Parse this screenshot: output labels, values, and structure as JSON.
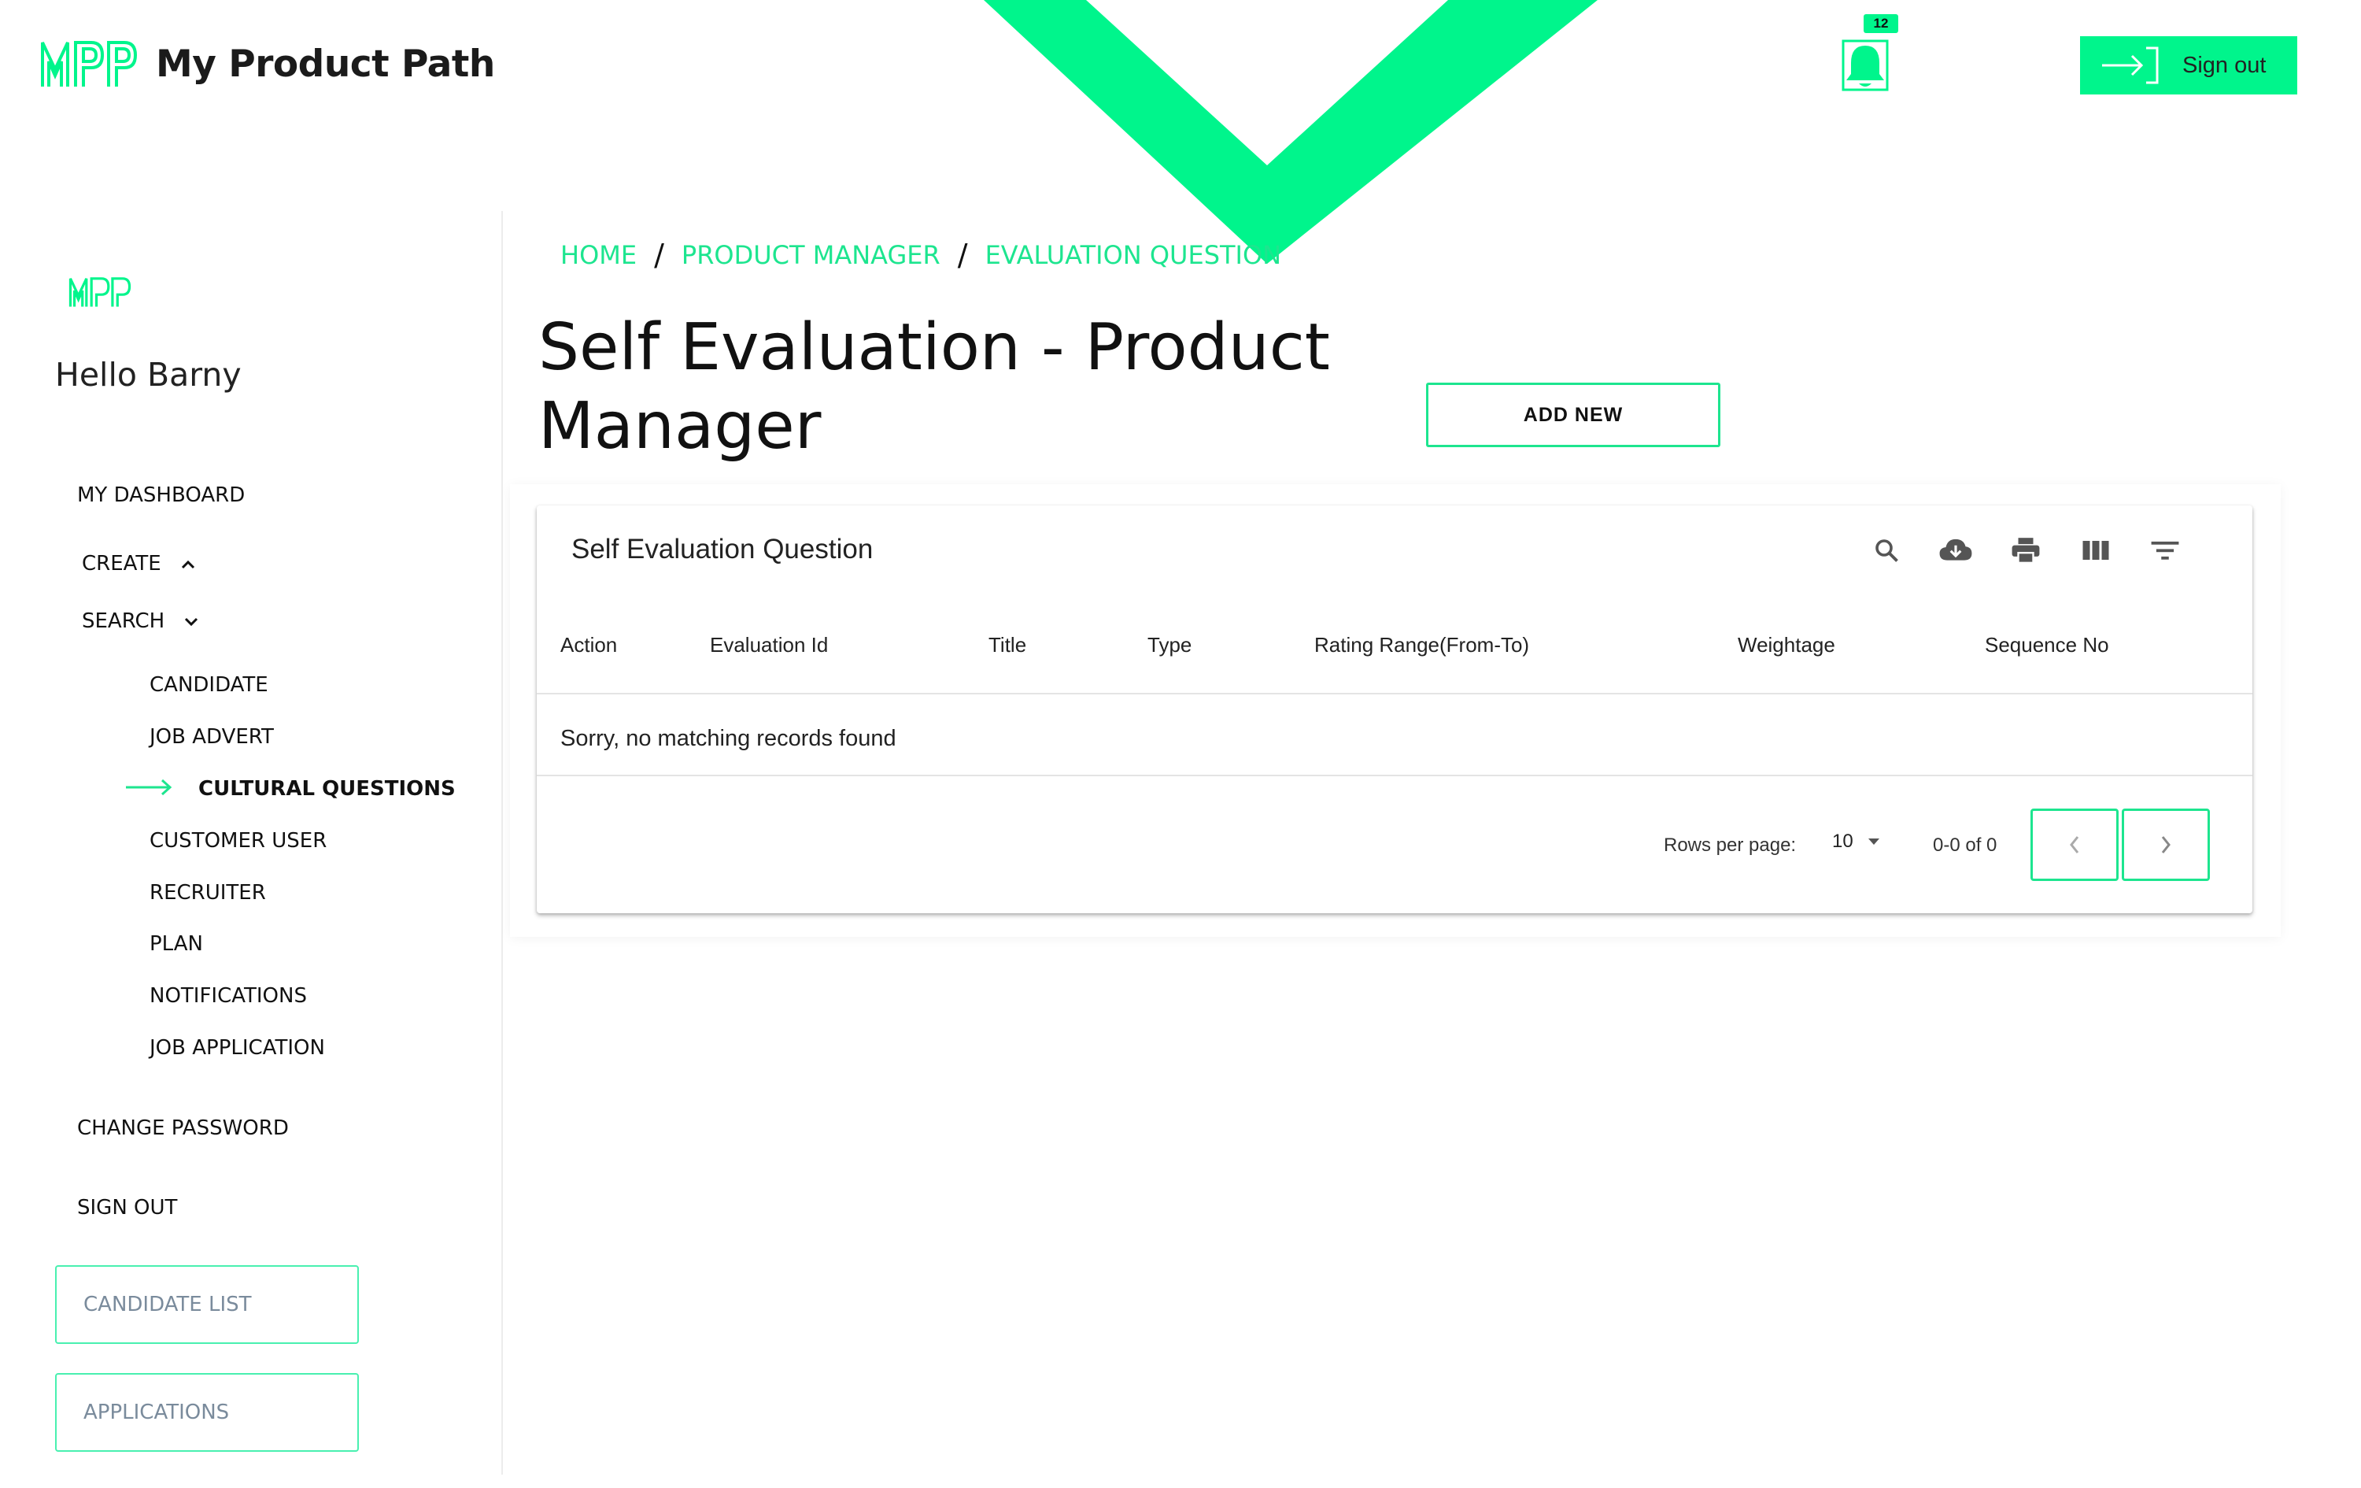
{
  "header": {
    "brand_mark": "MPP",
    "brand_title": "My Product Path",
    "notification_count": "12",
    "signout_label": "Sign out",
    "accent_color": "#00f58c"
  },
  "sidebar": {
    "logo_mark": "MPP",
    "greeting": "Hello Barny",
    "my_dashboard": "MY DASHBOARD",
    "create": "CREATE",
    "search": "SEARCH",
    "search_items": [
      "CANDIDATE",
      "JOB ADVERT",
      "CULTURAL QUESTIONS",
      "CUSTOMER USER",
      "RECRUITER",
      "PLAN",
      "NOTIFICATIONS",
      "JOB APPLICATION"
    ],
    "active_item": "CULTURAL QUESTIONS",
    "change_password": "CHANGE PASSWORD",
    "sign_out": "SIGN OUT",
    "candidate_list_button": "CANDIDATE LIST",
    "applications_button": "APPLICATIONS"
  },
  "breadcrumb": [
    "HOME",
    "PRODUCT MANAGER",
    "EVALUATION QUESTION"
  ],
  "page": {
    "title": "Self Evaluation - Product Manager",
    "add_new_label": "ADD NEW"
  },
  "table": {
    "title": "Self Evaluation Question",
    "toolbar_icons": [
      "search-icon",
      "download-icon",
      "print-icon",
      "view-columns-icon",
      "filter-icon"
    ],
    "columns": [
      "Action",
      "Evaluation Id",
      "Title",
      "Type",
      "Rating Range(From-To)",
      "Weightage",
      "Sequence No"
    ],
    "rows": [],
    "empty_message": "Sorry, no matching records found",
    "rows_per_page_label": "Rows per page:",
    "rows_per_page_value": "10",
    "range_text": "0-0 of 0"
  }
}
